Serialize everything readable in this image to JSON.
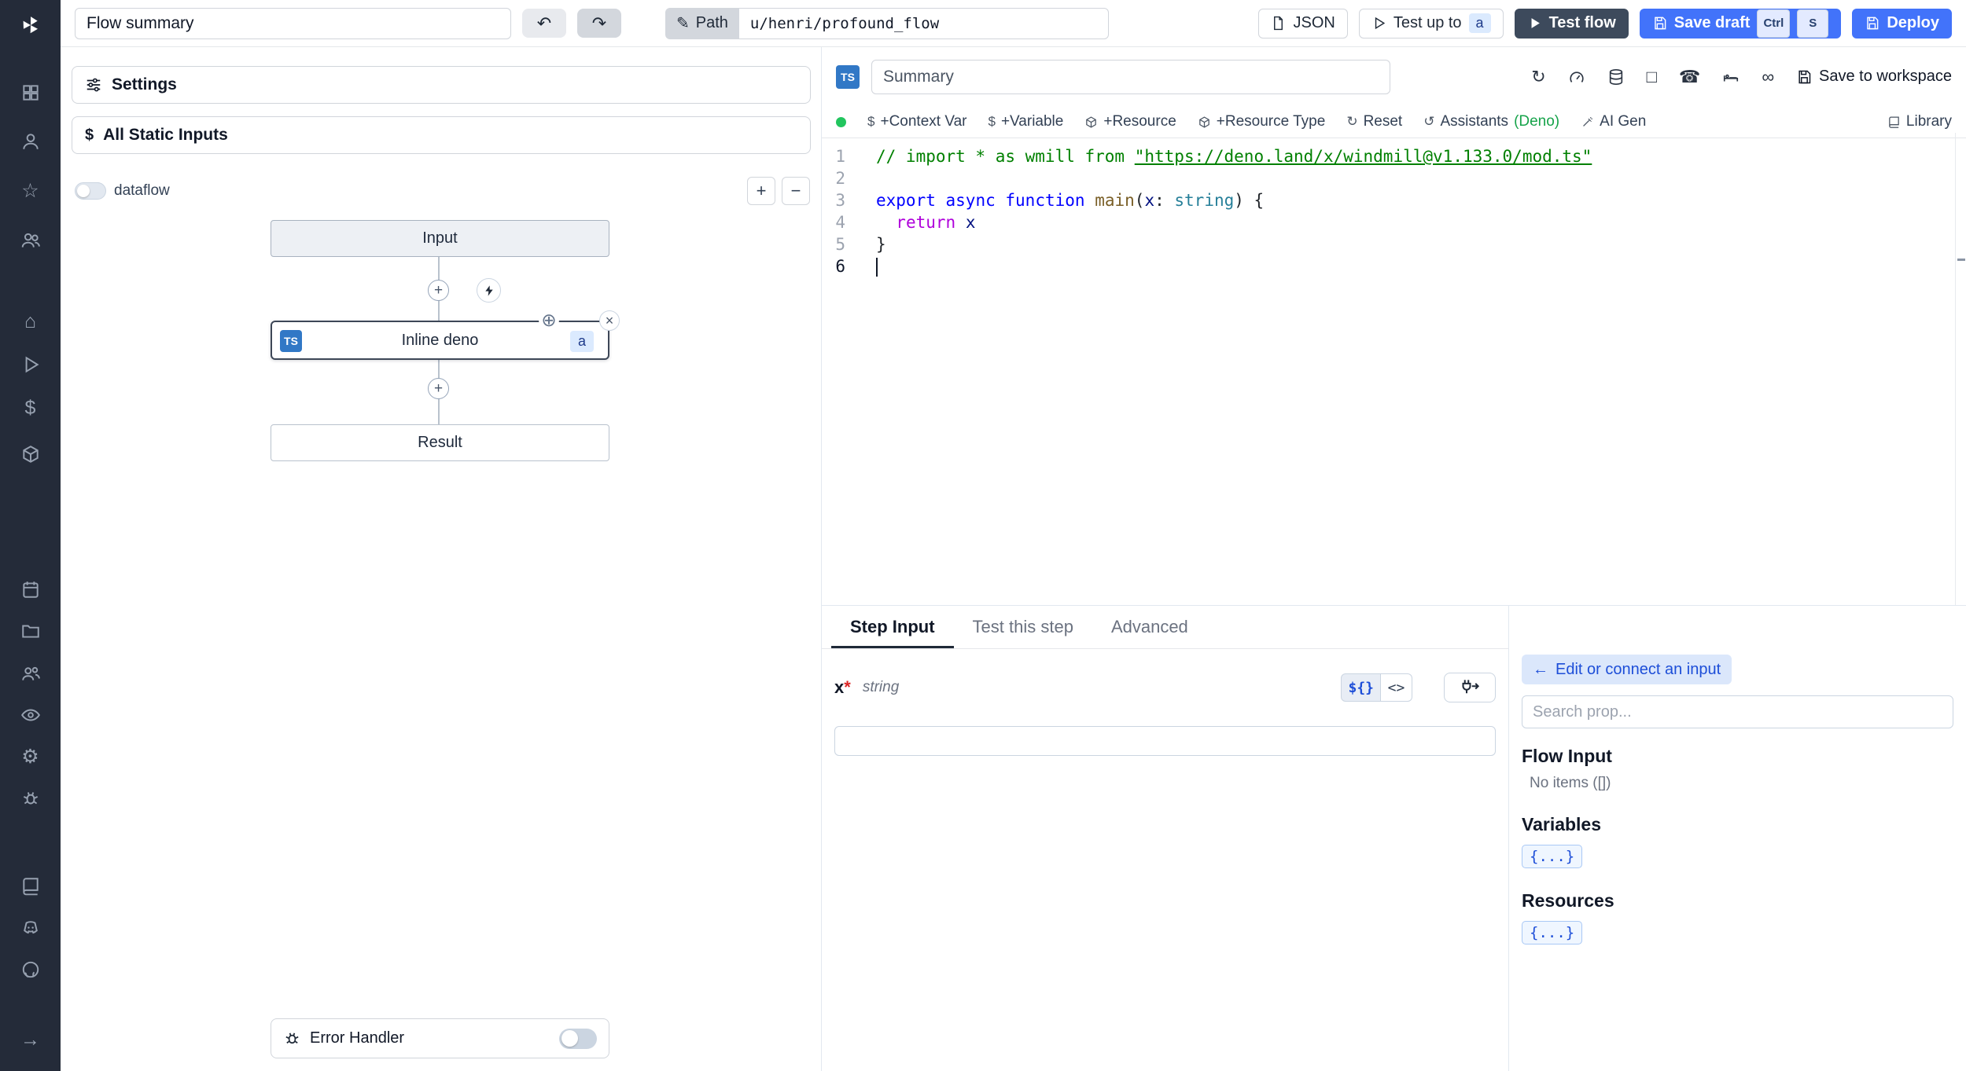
{
  "topbar": {
    "flow_summary": "Flow summary",
    "path_label": "Path",
    "path_value": "u/henri/profound_flow",
    "json_label": "JSON",
    "test_up_to_label": "Test up to",
    "test_up_to_badge": "a",
    "test_flow_label": "Test flow",
    "save_draft_label": "Save draft",
    "kbd_ctrl": "Ctrl",
    "kbd_s": "S",
    "deploy_label": "Deploy"
  },
  "flow_panel": {
    "settings_label": "Settings",
    "static_inputs_label": "All Static Inputs",
    "dataflow_label": "dataflow",
    "zoom_in": "+",
    "zoom_out": "−",
    "input_node": "Input",
    "step_node": "Inline deno",
    "step_lang_badge": "TS",
    "step_id_badge": "a",
    "result_node": "Result",
    "error_handler_label": "Error Handler"
  },
  "editor": {
    "lang_badge": "TS",
    "summary_placeholder": "Summary",
    "save_to_workspace": "Save to workspace",
    "actions": {
      "context_var": "+Context Var",
      "variable": "+Variable",
      "resource": "+Resource",
      "resource_type": "+Resource Type",
      "reset": "Reset",
      "assistants": "Assistants",
      "assistants_lang": "(Deno)",
      "ai_gen": "AI Gen",
      "library": "Library"
    },
    "code": {
      "language": "typescript",
      "active_line": 6,
      "cursor_line": 6,
      "lines": [
        [
          {
            "t": "// import * as wmill from ",
            "c": "cmt"
          },
          {
            "t": "\"https://deno.land/x/windmill@v1.133.0/mod.ts\"",
            "c": "cmt lnk"
          }
        ],
        [],
        [
          {
            "t": "export",
            "c": "kw"
          },
          {
            "t": " ",
            "c": "pl"
          },
          {
            "t": "async",
            "c": "kw"
          },
          {
            "t": " ",
            "c": "pl"
          },
          {
            "t": "function",
            "c": "kw"
          },
          {
            "t": " ",
            "c": "pl"
          },
          {
            "t": "main",
            "c": "fn"
          },
          {
            "t": "(",
            "c": "pl"
          },
          {
            "t": "x",
            "c": "vr"
          },
          {
            "t": ": ",
            "c": "pl"
          },
          {
            "t": "string",
            "c": "ty"
          },
          {
            "t": ") {",
            "c": "pl"
          }
        ],
        [
          {
            "t": "  ",
            "c": "pl"
          },
          {
            "t": "return",
            "c": "ct"
          },
          {
            "t": " ",
            "c": "pl"
          },
          {
            "t": "x",
            "c": "vr"
          }
        ],
        [
          {
            "t": "}",
            "c": "pl"
          }
        ],
        []
      ]
    }
  },
  "step_panel": {
    "tabs": [
      "Step Input",
      "Test this step",
      "Advanced"
    ],
    "active_tab": "Step Input",
    "field_name": "x",
    "required_mark": "*",
    "field_type": "string",
    "expr_toggle": "${}",
    "code_toggle": "<>",
    "input_value": ""
  },
  "connect_panel": {
    "edit_button": "Edit or connect an input",
    "search_placeholder": "Search prop...",
    "flow_input_title": "Flow Input",
    "flow_input_empty": "No items ([])",
    "variables_title": "Variables",
    "variables_badge": "{...}",
    "resources_title": "Resources",
    "resources_badge": "{...}"
  },
  "icons": {
    "undo": "↶",
    "redo": "↷",
    "pencil": "✎",
    "play": "▶",
    "plus": "+",
    "minus": "−",
    "close": "×",
    "crosshair": "⊕",
    "dollar": "$",
    "refresh": "↻",
    "assistants_refresh": "↺",
    "infinity": "∞",
    "phone": "☎",
    "square": "□",
    "arrow_left": "←",
    "arrow_right": "→",
    "gear": "⚙",
    "star": "☆",
    "home": "⌂",
    "eye": "◉"
  },
  "colors": {
    "primary_blue": "#4273fa",
    "dark_button": "#3d4a5c",
    "rail_bg": "#242b39",
    "ts_badge_blue": "#3178c6",
    "deno_green": "#16a34a",
    "status_green": "#22c55e"
  }
}
